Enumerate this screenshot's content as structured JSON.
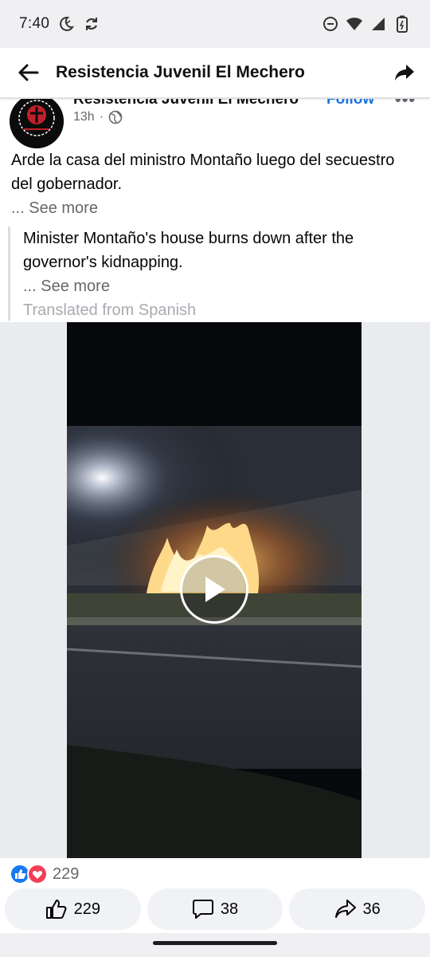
{
  "status_bar": {
    "time": "7:40",
    "icons": [
      "do-not-disturb-moon-icon",
      "sync-icon",
      "dnd-minus-icon",
      "wifi-icon",
      "signal-icon",
      "battery-icon"
    ]
  },
  "header": {
    "back_icon": "arrow-left-icon",
    "title": "Resistencia Juvenil El Mechero",
    "share_icon": "share-arrow-icon"
  },
  "post": {
    "author": "Resistencia Juvenil El Mechero",
    "follow_label": "Follow",
    "more_label": "•••",
    "time": "13h",
    "separator": "·",
    "privacy_icon": "globe-icon",
    "text": "Arde la casa del ministro Montaño luego del secuestro del gobernador.",
    "see_more": "... See more",
    "translation": {
      "text": "Minister Montaño's house burns down after the governor's kidnapping.",
      "see_more": "... See more",
      "note": "Translated from Spanish"
    },
    "video": {
      "play_icon": "play-icon"
    }
  },
  "reactions": {
    "icons": [
      "like-reaction-icon",
      "love-reaction-icon"
    ],
    "count": "229"
  },
  "actions": {
    "like_count": "229",
    "comment_count": "38",
    "share_count": "36"
  },
  "colors": {
    "accent": "#1b74e4",
    "secondary_text": "#65676b",
    "love": "#f33e58"
  }
}
